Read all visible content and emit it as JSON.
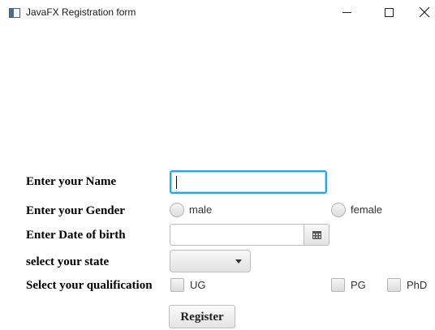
{
  "window": {
    "title": "JavaFX Registration form",
    "app_icon": "window-app-icon",
    "controls": [
      "minimize-icon",
      "maximize-icon",
      "close-icon"
    ]
  },
  "form": {
    "name_label": "Enter your Name",
    "name_value": "",
    "gender_label": "Enter your Gender",
    "gender_options": [
      {
        "label": "male",
        "selected": false
      },
      {
        "label": "female",
        "selected": false
      }
    ],
    "dob_label": "Enter Date of birth",
    "dob_value": "",
    "state_label": "select your state",
    "state_value": "",
    "qualification_label": "Select your qualification",
    "qualification_options": [
      {
        "label": "UG",
        "checked": false
      },
      {
        "label": "PG",
        "checked": false
      },
      {
        "label": "PhD",
        "checked": false
      }
    ],
    "submit_label": "Register"
  },
  "colors": {
    "focus_border": "#29a6de",
    "background": "#ffffff",
    "label_text": "#000000"
  }
}
